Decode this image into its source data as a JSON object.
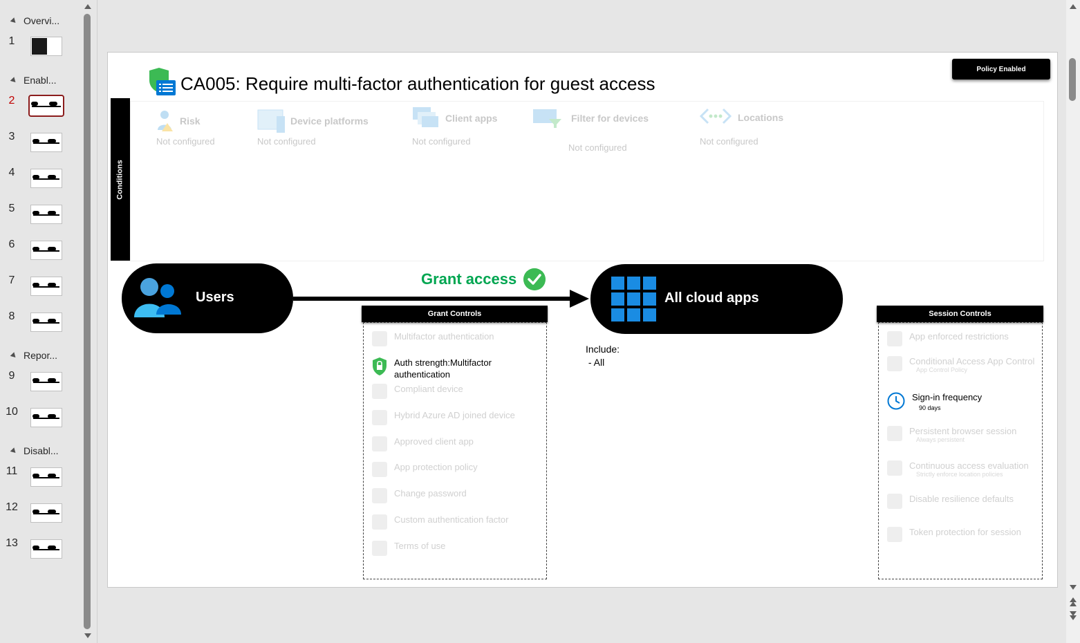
{
  "thumbnail_pane": {
    "sections": [
      {
        "label": "Overvi...",
        "slides": [
          "1"
        ]
      },
      {
        "label": "Enabl...",
        "slides": [
          "2",
          "3",
          "4",
          "5",
          "6",
          "7",
          "8"
        ]
      },
      {
        "label": "Repor...",
        "slides": [
          "9",
          "10"
        ]
      },
      {
        "label": "Disabl...",
        "slides": [
          "11",
          "12",
          "13"
        ]
      }
    ],
    "active_slide": "2"
  },
  "slide": {
    "policy_status": "Policy Enabled",
    "title": "CA005: Require multi-factor authentication for guest access",
    "conditions_label": "Conditions",
    "conditions": [
      {
        "name": "Risk",
        "value": "Not configured"
      },
      {
        "name": "Device platforms",
        "value": "Not configured"
      },
      {
        "name": "Client apps",
        "value": "Not configured"
      },
      {
        "name": "Filter for devices",
        "value": "Not configured"
      },
      {
        "name": "Locations",
        "value": "Not configured"
      }
    ],
    "users_label": "Users",
    "grant_label": "Grant access",
    "apps_label": "All cloud apps",
    "include_text": "Include:\n - All",
    "grant_controls": {
      "header": "Grant Controls",
      "items": [
        {
          "label": "Multifactor authentication",
          "active": false
        },
        {
          "label": "Auth strength:Multifactor",
          "label2": "authentication",
          "active": true
        },
        {
          "label": "Compliant device",
          "active": false
        },
        {
          "label": "Hybrid Azure AD joined device",
          "active": false
        },
        {
          "label": "Approved client app",
          "active": false
        },
        {
          "label": "App protection policy",
          "active": false
        },
        {
          "label": "Change password",
          "active": false
        },
        {
          "label": "Custom authentication factor",
          "active": false
        },
        {
          "label": "Terms of use",
          "active": false
        }
      ]
    },
    "session_controls": {
      "header": "Session Controls",
      "items": [
        {
          "label": "App enforced restrictions",
          "sub": "",
          "active": false
        },
        {
          "label": "Conditional Access App Control",
          "sub": "App Control Policy",
          "active": false
        },
        {
          "label": "Sign-in frequency",
          "sub": "90 days",
          "active": true
        },
        {
          "label": "Persistent browser session",
          "sub": "Always persistent",
          "active": false
        },
        {
          "label": "Continuous access evaluation",
          "sub": "Strictly enforce location policies",
          "active": false
        },
        {
          "label": "Disable resilience defaults",
          "sub": "",
          "active": false
        },
        {
          "label": "Token protection for session",
          "sub": "",
          "active": false
        }
      ]
    }
  },
  "colors": {
    "grant_green": "#00a651",
    "accent_blue": "#0078d4",
    "active_thumb_border": "#8b1c1c"
  }
}
